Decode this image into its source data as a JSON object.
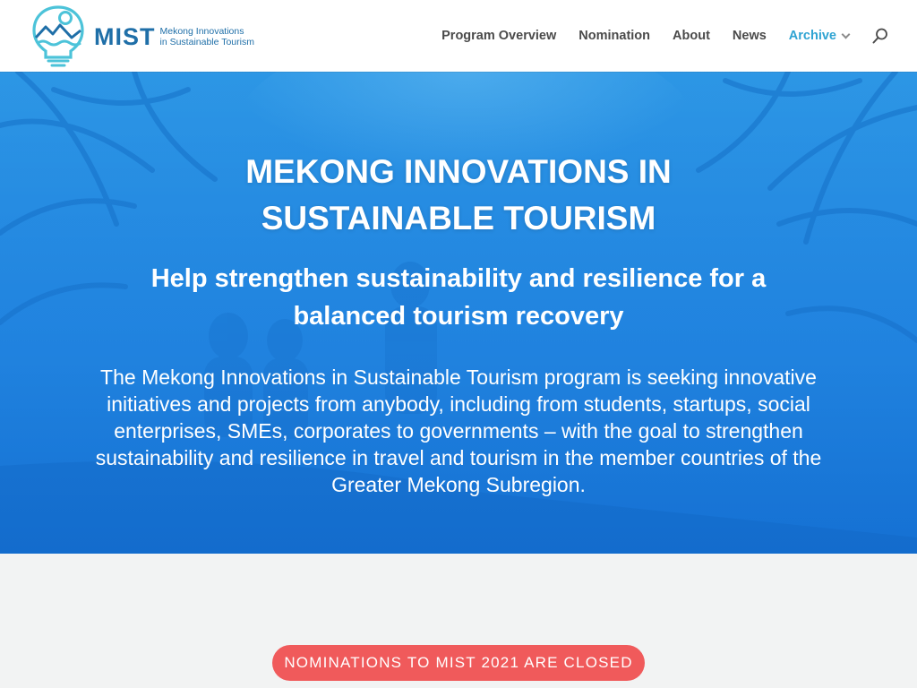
{
  "header": {
    "logo": {
      "wordmark": "MIST",
      "tagline_line1": "Mekong Innovations",
      "tagline_line2": "in Sustainable Tourism",
      "icon": "lightbulb-mountain-icon",
      "color": "#1f6fa8",
      "accent": "#4cc3d9"
    },
    "nav": {
      "items": [
        {
          "label": "Program Overview",
          "active": false
        },
        {
          "label": "Nomination",
          "active": false
        },
        {
          "label": "About",
          "active": false
        },
        {
          "label": "News",
          "active": false
        },
        {
          "label": "Archive",
          "active": true,
          "has_dropdown": true
        }
      ],
      "search_icon": "search-icon"
    }
  },
  "hero": {
    "title": "MEKONG INNOVATIONS IN SUSTAINABLE TOURISM",
    "subtitle": "Help strengthen sustainability and resilience for a balanced tourism recovery",
    "text": "The Mekong Innovations in Sustainable Tourism program is seeking innovative initiatives and projects from anybody, including from students, startups, social enterprises, SMEs, corporates to governments – with the goal to strengthen sustainability and resilience in travel and tourism in the member countries of the Greater Mekong Subregion."
  },
  "cta": {
    "label": "NOMINATIONS TO MIST 2021 ARE CLOSED",
    "color": "#f05a5b"
  },
  "colors": {
    "nav_text": "#4a4a4a",
    "nav_active": "#2ea3d2",
    "hero_tint": "#1a7fd6",
    "lower_bg": "#f2f3f3"
  }
}
